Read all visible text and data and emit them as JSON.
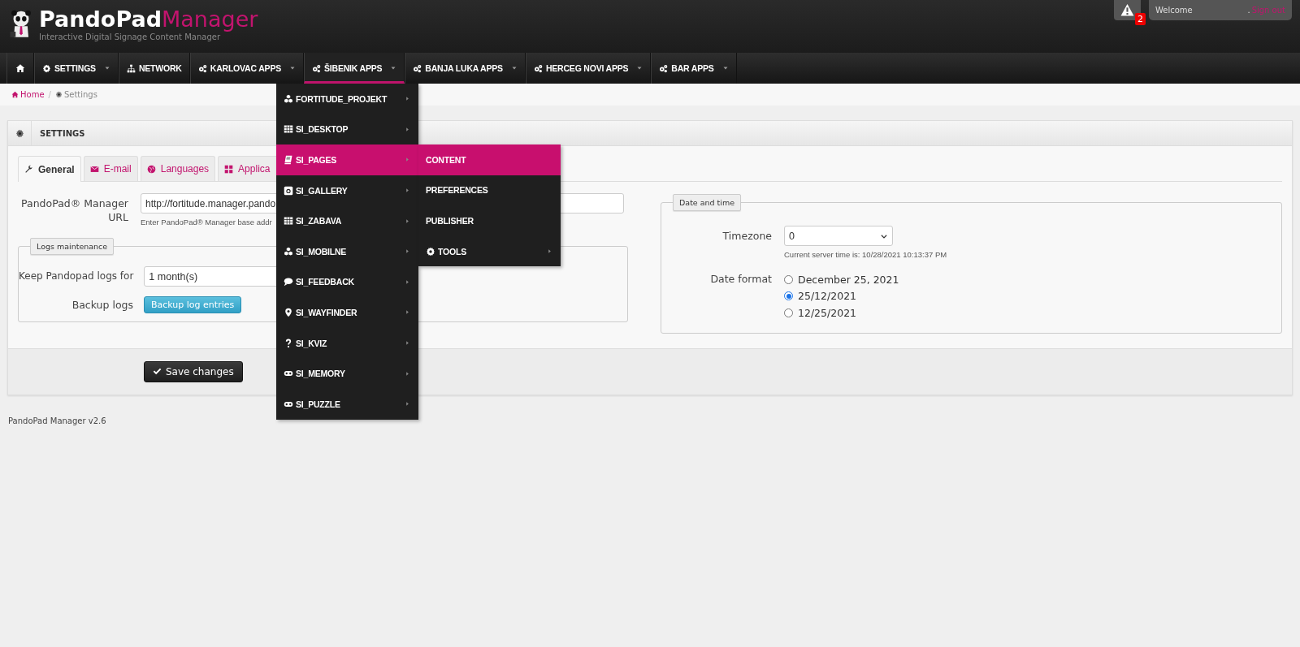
{
  "header": {
    "brand_name": "PandoPad",
    "brand_suffix": "Manager",
    "tagline": "Interactive Digital Signage Content Manager",
    "alert_count": "2",
    "welcome": "Welcome",
    "separator": ".",
    "sign_out": "Sign out"
  },
  "nav": {
    "items": [
      {
        "label": "SETTINGS",
        "dropdown": true,
        "selected": false
      },
      {
        "label": "NETWORK",
        "dropdown": false,
        "selected": false
      },
      {
        "label": "KARLOVAC APPS",
        "dropdown": true,
        "selected": false
      },
      {
        "label": "ŠIBENIK APPS",
        "dropdown": true,
        "selected": true
      },
      {
        "label": "BANJA LUKA APPS",
        "dropdown": true,
        "selected": false
      },
      {
        "label": "HERCEG NOVI APPS",
        "dropdown": true,
        "selected": false
      },
      {
        "label": "BAR APPS",
        "dropdown": true,
        "selected": false
      }
    ]
  },
  "menu": {
    "items": [
      {
        "label": "FORTITUDE_PROJEKT",
        "selected": false,
        "has_submenu": true
      },
      {
        "label": "SI_DESKTOP",
        "selected": false,
        "has_submenu": true
      },
      {
        "label": "SI_PAGES",
        "selected": true,
        "has_submenu": true
      },
      {
        "label": "SI_GALLERY",
        "selected": false,
        "has_submenu": true
      },
      {
        "label": "SI_ZABAVA",
        "selected": false,
        "has_submenu": true
      },
      {
        "label": "SI_MOBILNE",
        "selected": false,
        "has_submenu": true
      },
      {
        "label": "SI_FEEDBACK",
        "selected": false,
        "has_submenu": true
      },
      {
        "label": "SI_WAYFINDER",
        "selected": false,
        "has_submenu": true
      },
      {
        "label": "SI_KVIZ",
        "selected": false,
        "has_submenu": true
      },
      {
        "label": "SI_MEMORY",
        "selected": false,
        "has_submenu": true
      },
      {
        "label": "SI_PUZZLE",
        "selected": false,
        "has_submenu": true
      }
    ],
    "submenu": [
      {
        "label": "CONTENT",
        "selected": true,
        "has_submenu": false
      },
      {
        "label": "PREFERENCES",
        "selected": false,
        "has_submenu": false
      },
      {
        "label": "PUBLISHER",
        "selected": false,
        "has_submenu": false
      },
      {
        "label": "TOOLS",
        "selected": false,
        "has_submenu": true
      }
    ]
  },
  "breadcrumb_separator": "/",
  "breadcrumb": [
    {
      "label": "Home",
      "current": false
    },
    {
      "label": "Settings",
      "current": true
    }
  ],
  "panel": {
    "title": "SETTINGS",
    "tabs": [
      {
        "label": "General",
        "selected": true
      },
      {
        "label": "E-mail",
        "selected": false
      },
      {
        "label": "Languages",
        "selected": false
      },
      {
        "label": "Applica",
        "selected": false
      }
    ],
    "url_label": "PandoPad® Manager URL",
    "url_value": "http://fortitude.manager.pando",
    "url_help": "Enter PandoPad® Manager base addr",
    "logs_legend": "Logs maintenance",
    "keep_label": "Keep Pandopad logs for",
    "keep_value": "1 month(s)",
    "backup_label": "Backup logs",
    "backup_button": "Backup log entries",
    "dt_legend": "Date and time",
    "timezone_label": "Timezone",
    "timezone_value": "0",
    "server_time": "Current server time is: 10/28/2021 10:13:37 PM",
    "date_format_label": "Date format",
    "date_formats": [
      {
        "label": "December 25, 2021",
        "selected": false
      },
      {
        "label": "25/12/2021",
        "selected": true
      },
      {
        "label": "12/25/2021",
        "selected": false
      }
    ],
    "save_button": "Save changes"
  },
  "footer": "PandoPad Manager v2.6"
}
